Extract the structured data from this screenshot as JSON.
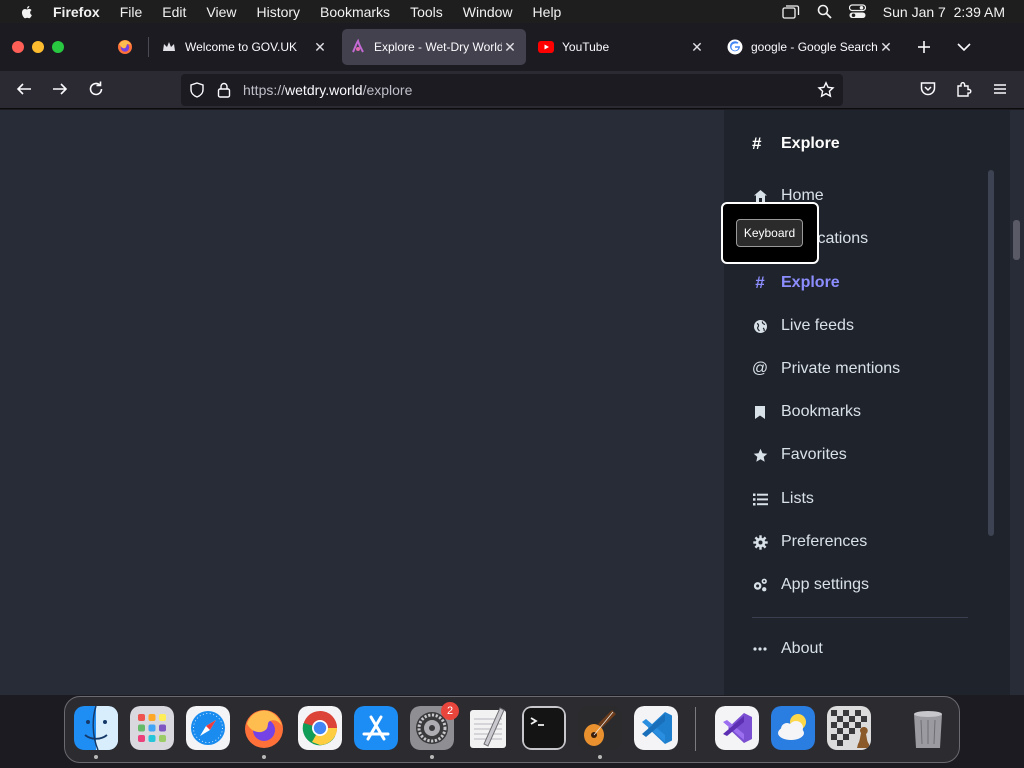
{
  "menubar": {
    "app_name": "Firefox",
    "items": [
      "File",
      "Edit",
      "View",
      "History",
      "Bookmarks",
      "Tools",
      "Window",
      "Help"
    ],
    "clock": "Sun Jan 7  2:39 AM"
  },
  "tabs": [
    {
      "title": "Welcome to GOV.UK",
      "active": false
    },
    {
      "title": "Explore - Wet-Dry World",
      "active": true
    },
    {
      "title": "YouTube",
      "active": false
    },
    {
      "title": "google - Google Search",
      "active": false
    }
  ],
  "urlbar": {
    "prefix": "https://",
    "domain": "wetdry.world",
    "path": "/explore"
  },
  "sidenav": {
    "header": "Explore",
    "items": [
      {
        "label": "Home",
        "icon": "home-icon"
      },
      {
        "label": "Notifications",
        "icon": "bell-icon"
      },
      {
        "label": "Explore",
        "icon": "hashtag-icon",
        "active": true
      },
      {
        "label": "Live feeds",
        "icon": "globe-icon"
      },
      {
        "label": "Private mentions",
        "icon": "at-icon"
      },
      {
        "label": "Bookmarks",
        "icon": "bookmark-icon"
      },
      {
        "label": "Favorites",
        "icon": "star-icon"
      },
      {
        "label": "Lists",
        "icon": "list-icon"
      },
      {
        "label": "Preferences",
        "icon": "gear-icon"
      },
      {
        "label": "App settings",
        "icon": "cogs-icon"
      },
      {
        "label": "About",
        "icon": "ellipsis-icon"
      }
    ],
    "accent_color": "#8c8dff"
  },
  "tooltip": {
    "label": "Keyboard"
  },
  "dock": {
    "settings_badge": "2",
    "apps": [
      "Finder",
      "Launchpad",
      "Safari",
      "Firefox",
      "Chrome",
      "App Store",
      "System Settings",
      "TextEdit",
      "Terminal",
      "GarageBand",
      "VS Code",
      "Visual Studio",
      "Weather",
      "Chess",
      "Trash"
    ]
  }
}
